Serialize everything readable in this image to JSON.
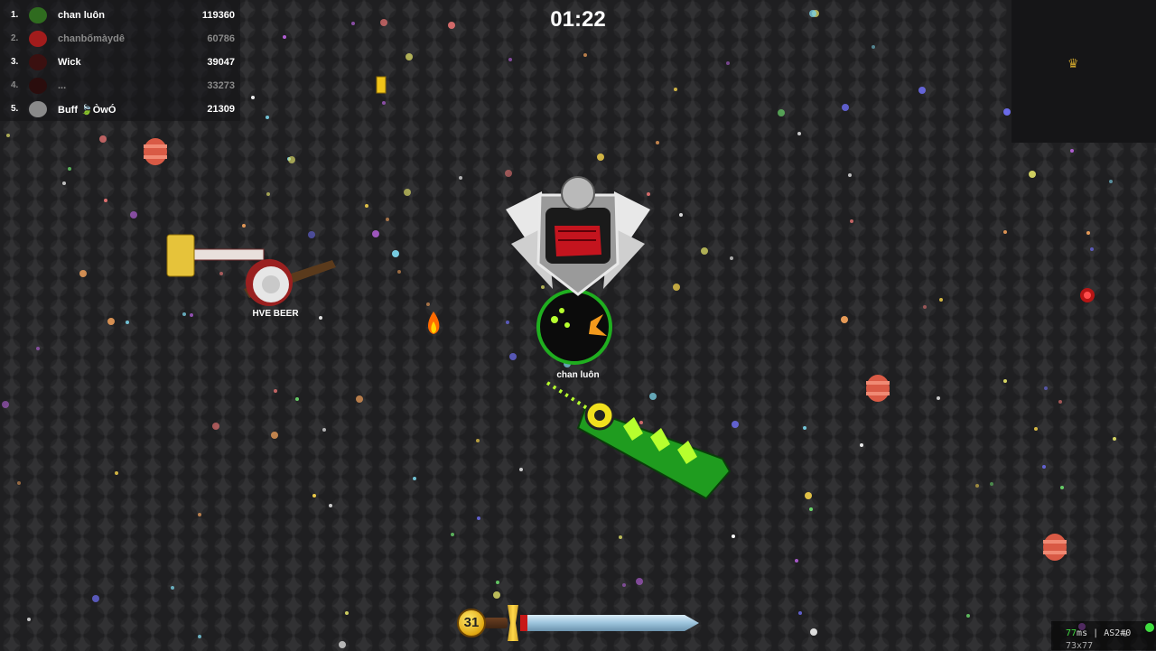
{
  "leaderboard": [
    {
      "rank": "1.",
      "name": "chan luôn",
      "score": "119360",
      "avatar_color": "#2f6b1f",
      "dim": false
    },
    {
      "rank": "2.",
      "name": "chanbốmàydê",
      "score": "60786",
      "avatar_color": "#a11c1c",
      "dim": true
    },
    {
      "rank": "3.",
      "name": "Wick",
      "score": "39047",
      "avatar_color": "#3a1010",
      "dim": false
    },
    {
      "rank": "4.",
      "name": "...",
      "score": "33273",
      "avatar_color": "#2a0d0d",
      "dim": true
    },
    {
      "rank": "5.",
      "name": "Buff 🍃ÒwÓ",
      "score": "21309",
      "avatar_color": "#8a8a8a",
      "dim": false
    }
  ],
  "timer": "01:22",
  "player": {
    "name": "chan luôn",
    "level": "31",
    "xp_progress": 0.02
  },
  "enemy": {
    "name": "HVE BEER"
  },
  "minimap": {
    "icon": "crown-icon"
  },
  "network": {
    "latency": "77",
    "latency_unit": "ms",
    "separator": "|",
    "server": "AS2#0",
    "coords": "73x77"
  },
  "colors": {
    "accent_green": "#1fae1f",
    "health_red": "#c81818",
    "gold": "#e0a812"
  }
}
